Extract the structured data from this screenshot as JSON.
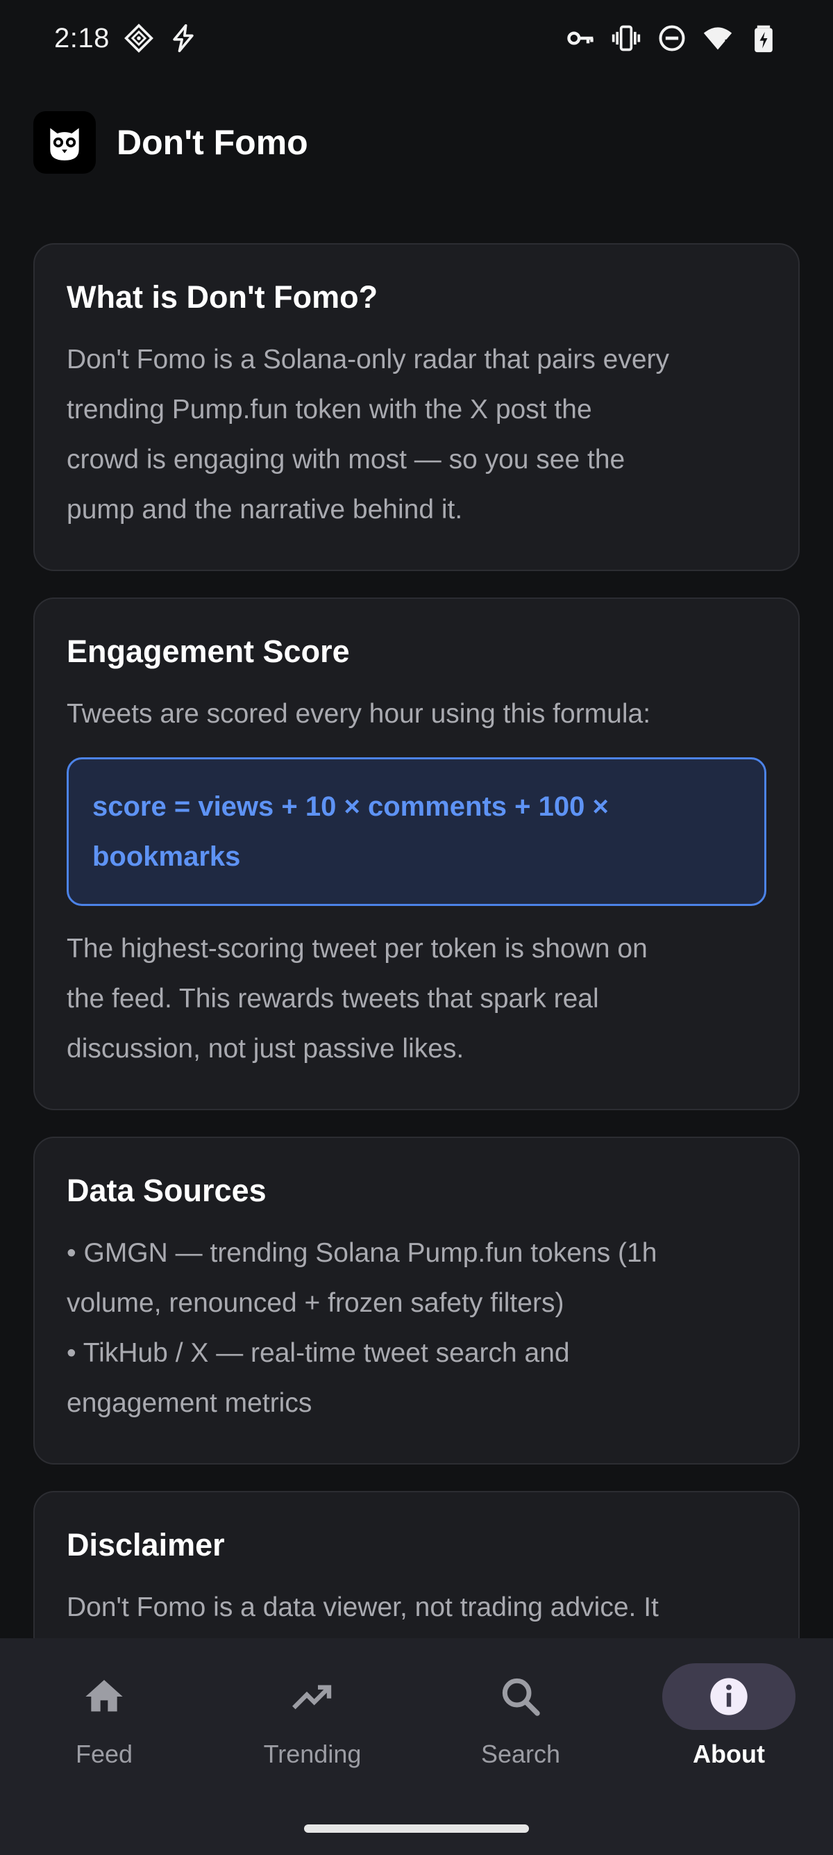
{
  "status_bar": {
    "time": "2:18",
    "icons": [
      "diamond-grid-icon",
      "bolt-icon",
      "key-icon",
      "vibrate-icon",
      "do-not-disturb-icon",
      "wifi-icon",
      "battery-charging-icon"
    ]
  },
  "app": {
    "title": "Don't Fomo",
    "logo_icon": "owl-icon"
  },
  "cards": {
    "about": {
      "title": "What is Don't Fomo?",
      "lines": [
        "Don't Fomo is a Solana-only radar that pairs every",
        "trending Pump.fun token with the X post the",
        "crowd is engaging with most — so you see the",
        "pump and the narrative behind it."
      ]
    },
    "engagement": {
      "title": "Engagement Score",
      "intro": "Tweets are scored every hour using this formula:",
      "formula_lines": [
        "score = views + 10 × comments + 100 ×",
        "bookmarks"
      ],
      "outro_lines": [
        "The highest-scoring tweet per token is shown on",
        "the feed. This rewards tweets that spark real",
        "discussion, not just passive likes."
      ]
    },
    "sources": {
      "title": "Data Sources",
      "lines": [
        "• GMGN — trending Solana Pump.fun tokens (1h",
        "volume, renounced + frozen safety filters)",
        "• TikHub / X — real-time tweet search and",
        "engagement metrics"
      ]
    },
    "disclaimer": {
      "title": "Disclaimer",
      "lines": [
        "Don't Fomo is a data viewer, not trading advice. It"
      ]
    }
  },
  "nav": {
    "items": [
      {
        "label": "Feed",
        "icon": "home-icon"
      },
      {
        "label": "Trending",
        "icon": "trending-up-icon"
      },
      {
        "label": "Search",
        "icon": "search-icon"
      },
      {
        "label": "About",
        "icon": "info-icon"
      }
    ],
    "active": "About"
  },
  "colors": {
    "background": "#111214",
    "card": "#1C1D21",
    "accent": "#5E93F5",
    "nav_active_pill": "#3F3C4E"
  }
}
